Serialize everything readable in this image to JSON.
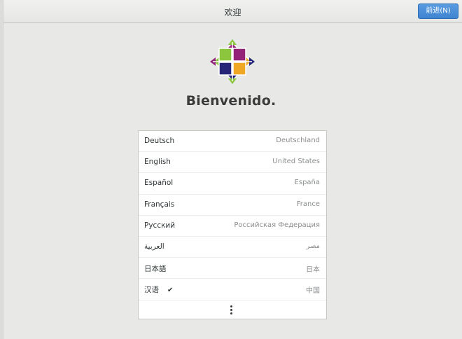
{
  "header": {
    "title": "欢迎",
    "next_button_label": "前进(N)"
  },
  "main": {
    "logo_icon": "centos-logo-icon",
    "welcome_title": "Bienvenido."
  },
  "languages": [
    {
      "name": "Deutsch",
      "region": "Deutschland",
      "selected": false
    },
    {
      "name": "English",
      "region": "United States",
      "selected": false
    },
    {
      "name": "Español",
      "region": "España",
      "selected": false
    },
    {
      "name": "Français",
      "region": "France",
      "selected": false
    },
    {
      "name": "Русский",
      "region": "Российская Федерация",
      "selected": false
    },
    {
      "name": "العربية",
      "region": "مصر",
      "selected": false
    },
    {
      "name": "日本語",
      "region": "日本",
      "selected": false
    },
    {
      "name": "汉语",
      "region": "中国",
      "selected": true
    }
  ],
  "more_icon": "more-vertical-icon",
  "colors": {
    "accent": "#3f84d2",
    "logo_purple": "#932279",
    "logo_green": "#8cc63e",
    "logo_orange": "#efa724",
    "logo_blue": "#262577"
  }
}
